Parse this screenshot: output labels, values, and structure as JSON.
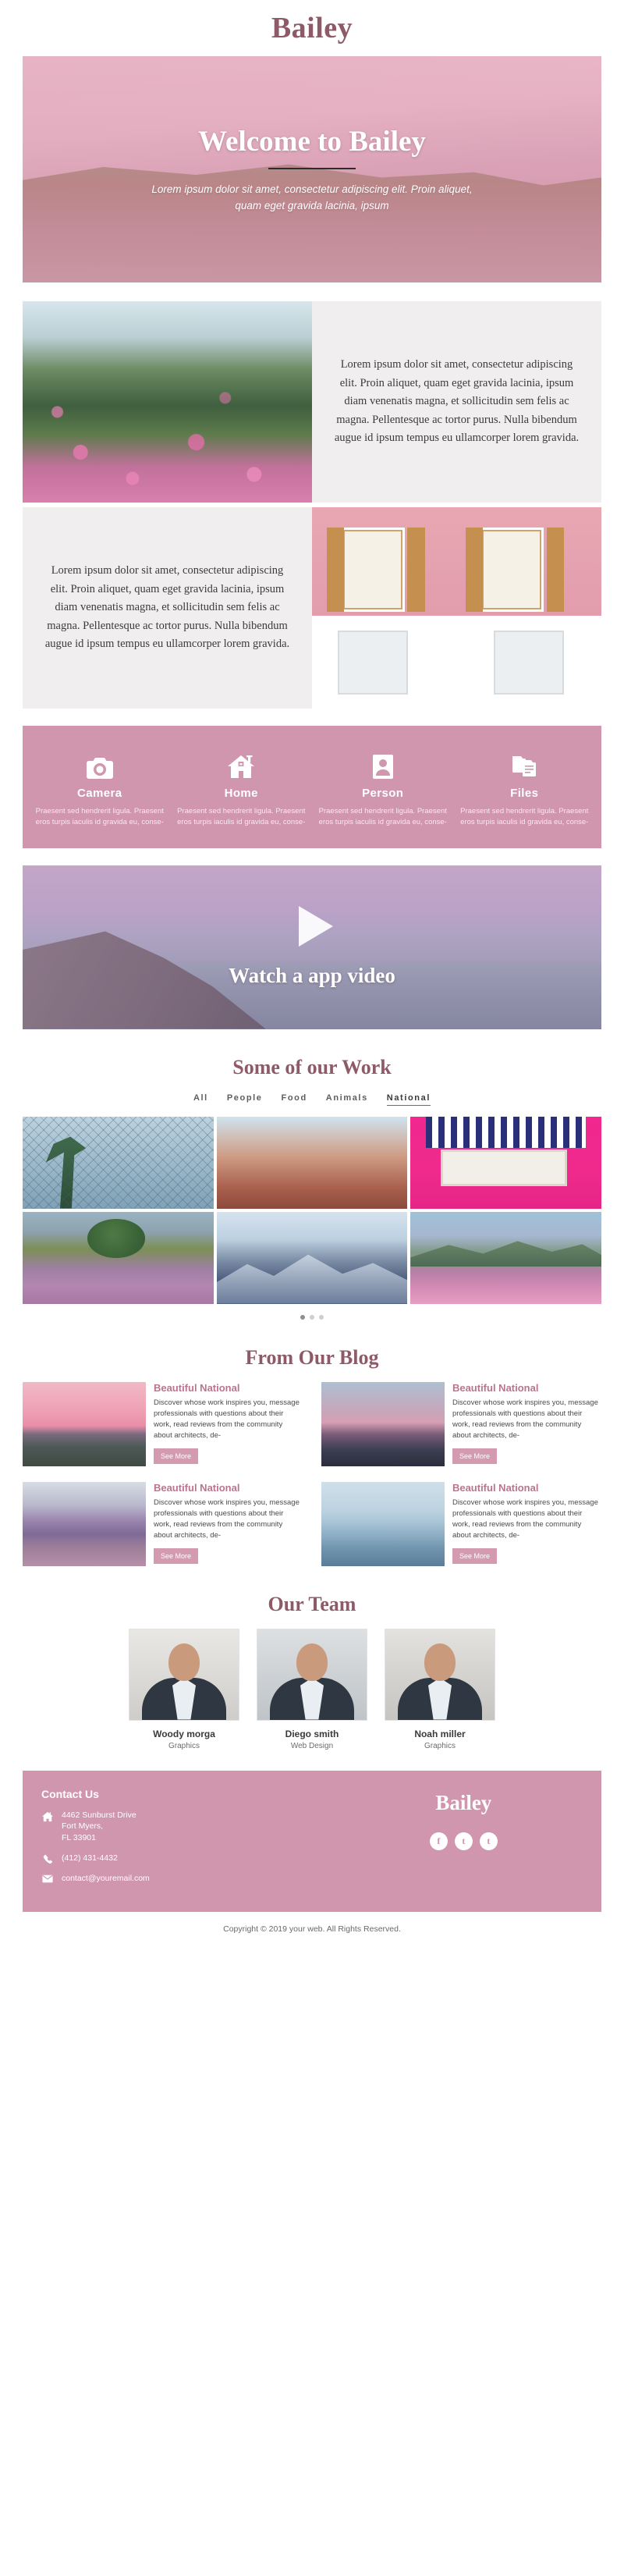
{
  "brand": {
    "name": "Bailey",
    "accent": "#8e5a67",
    "pink": "#cf96ad"
  },
  "hero": {
    "title": "Welcome to Bailey",
    "subtitle": "Lorem ipsum dolor sit amet, consectetur adipiscing elit. Proin aliquet, quam eget gravida lacinia, ipsum"
  },
  "about": {
    "paragraph_one": "Lorem ipsum dolor sit amet, consectetur adipiscing elit. Proin aliquet, quam eget gravida lacinia, ipsum diam venenatis magna, et sollicitudin sem felis ac magna. Pellentesque ac tortor purus. Nulla bibendum augue id ipsum tempus eu ullamcorper lorem gravida.",
    "paragraph_two": "Lorem ipsum dolor sit amet, consectetur adipiscing elit. Proin aliquet, quam eget gravida lacinia, ipsum diam venenatis magna, et sollicitudin sem felis ac magna. Pellentesque ac tortor purus. Nulla bibendum augue id ipsum tempus eu ullamcorper lorem gravida."
  },
  "features": [
    {
      "icon": "camera-icon",
      "title": "Camera",
      "desc": "Praesent sed hendrerit ligula. Praesent eros turpis iaculis id gravida eu, conse-"
    },
    {
      "icon": "home-icon",
      "title": "Home",
      "desc": "Praesent sed hendrerit ligula. Praesent eros turpis iaculis id gravida eu, conse-"
    },
    {
      "icon": "person-icon",
      "title": "Person",
      "desc": "Praesent sed hendrerit ligula. Praesent eros turpis iaculis id gravida eu, conse-"
    },
    {
      "icon": "files-icon",
      "title": "Files",
      "desc": "Praesent sed hendrerit ligula. Praesent eros turpis iaculis id gravida eu, conse-"
    }
  ],
  "video": {
    "title": "Watch a app video",
    "play_icon": "play-icon"
  },
  "work": {
    "title": "Some of our Work",
    "tabs": [
      {
        "label": "All",
        "active": false
      },
      {
        "label": "People",
        "active": false
      },
      {
        "label": "Food",
        "active": false
      },
      {
        "label": "Animals",
        "active": false
      },
      {
        "label": "National",
        "active": true
      }
    ],
    "tiles": [
      {
        "name": "palm-fence-photo"
      },
      {
        "name": "canyon-photo"
      },
      {
        "name": "bicycle-pink-wall-photo"
      },
      {
        "name": "lavender-field-photo"
      },
      {
        "name": "mountain-peak-photo"
      },
      {
        "name": "purple-hills-photo"
      }
    ],
    "dots": [
      {
        "active": true
      },
      {
        "active": false
      },
      {
        "active": false
      }
    ]
  },
  "blog": {
    "title": "From Our Blog",
    "posts": [
      {
        "title": "Beautiful National",
        "excerpt": "Discover whose work inspires you, message professionals with questions about their work, read reviews from the community about architects, de-",
        "button": "See More"
      },
      {
        "title": "Beautiful National",
        "excerpt": "Discover whose work inspires you, message professionals with questions about their work, read reviews from the community about architects, de-",
        "button": "See More"
      },
      {
        "title": "Beautiful National",
        "excerpt": "Discover whose work inspires you, message professionals with questions about their work, read reviews from the community about architects, de-",
        "button": "See More"
      },
      {
        "title": "Beautiful National",
        "excerpt": "Discover whose work inspires you, message professionals with questions about their work, read reviews from the community about architects, de-",
        "button": "See More"
      }
    ]
  },
  "team": {
    "title": "Our Team",
    "members": [
      {
        "name": "Woody morga",
        "role": "Graphics"
      },
      {
        "name": "Diego smith",
        "role": "Web Design"
      },
      {
        "name": "Noah miller",
        "role": "Graphics"
      }
    ]
  },
  "footer": {
    "heading": "Contact Us",
    "address": "4462 Sunburst Drive\nFort Myers,\nFL 33901",
    "phone": "(412) 431-4432",
    "email": "contact@youremail.com",
    "logo": "Bailey",
    "socials": [
      {
        "name": "facebook-icon",
        "glyph": "f"
      },
      {
        "name": "twitter-bird-icon",
        "glyph": "t"
      },
      {
        "name": "twitter-icon",
        "glyph": "t"
      }
    ],
    "copyright": "Copyright © 2019 your web. All Rights Reserved."
  }
}
